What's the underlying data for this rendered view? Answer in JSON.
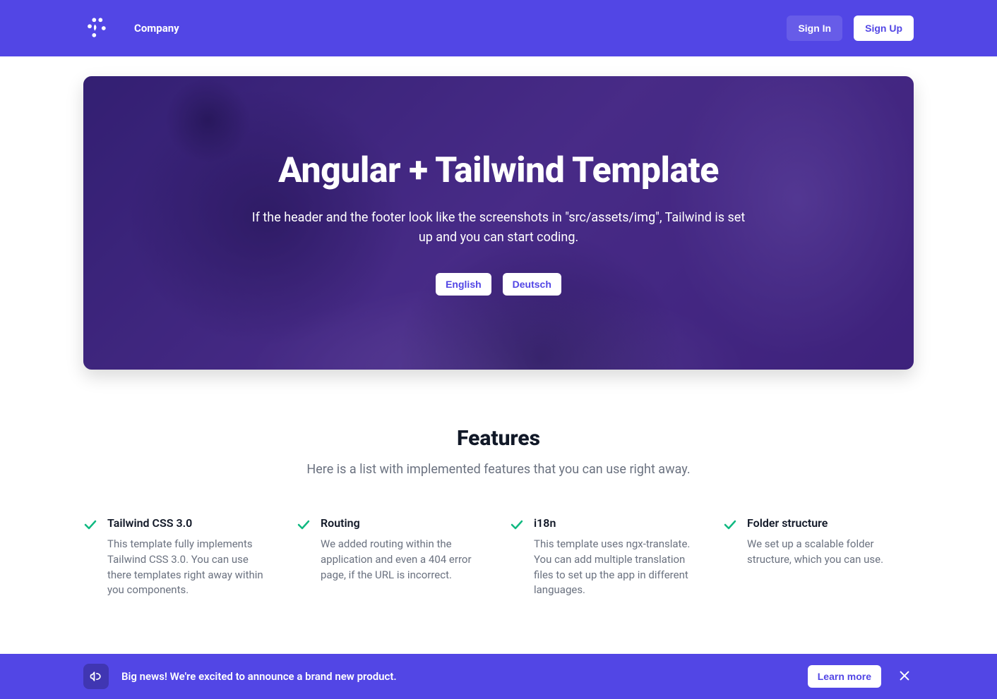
{
  "header": {
    "company_name": "Company",
    "signin_label": "Sign In",
    "signup_label": "Sign Up"
  },
  "hero": {
    "title": "Angular + Tailwind Template",
    "subtitle": "If the header and the footer look like the screenshots in \"src/assets/img\", Tailwind is set up and you can start coding.",
    "lang_en": "English",
    "lang_de": "Deutsch"
  },
  "features": {
    "title": "Features",
    "subtitle": "Here is a list with implemented features that you can use right away.",
    "items": [
      {
        "title": "Tailwind CSS 3.0",
        "desc": "This template fully implements Tailwind CSS 3.0. You can use there templates right away within you components."
      },
      {
        "title": "Routing",
        "desc": "We added routing within the application and even a 404 error page, if the URL is incorrect."
      },
      {
        "title": "i18n",
        "desc": "This template uses ngx-translate. You can add multiple translation files to set up the app in different languages."
      },
      {
        "title": "Folder structure",
        "desc": "We set up a scalable folder structure, which you can use."
      }
    ]
  },
  "banner": {
    "text": "Big news! We're excited to announce a brand new product.",
    "learn_more": "Learn more"
  }
}
